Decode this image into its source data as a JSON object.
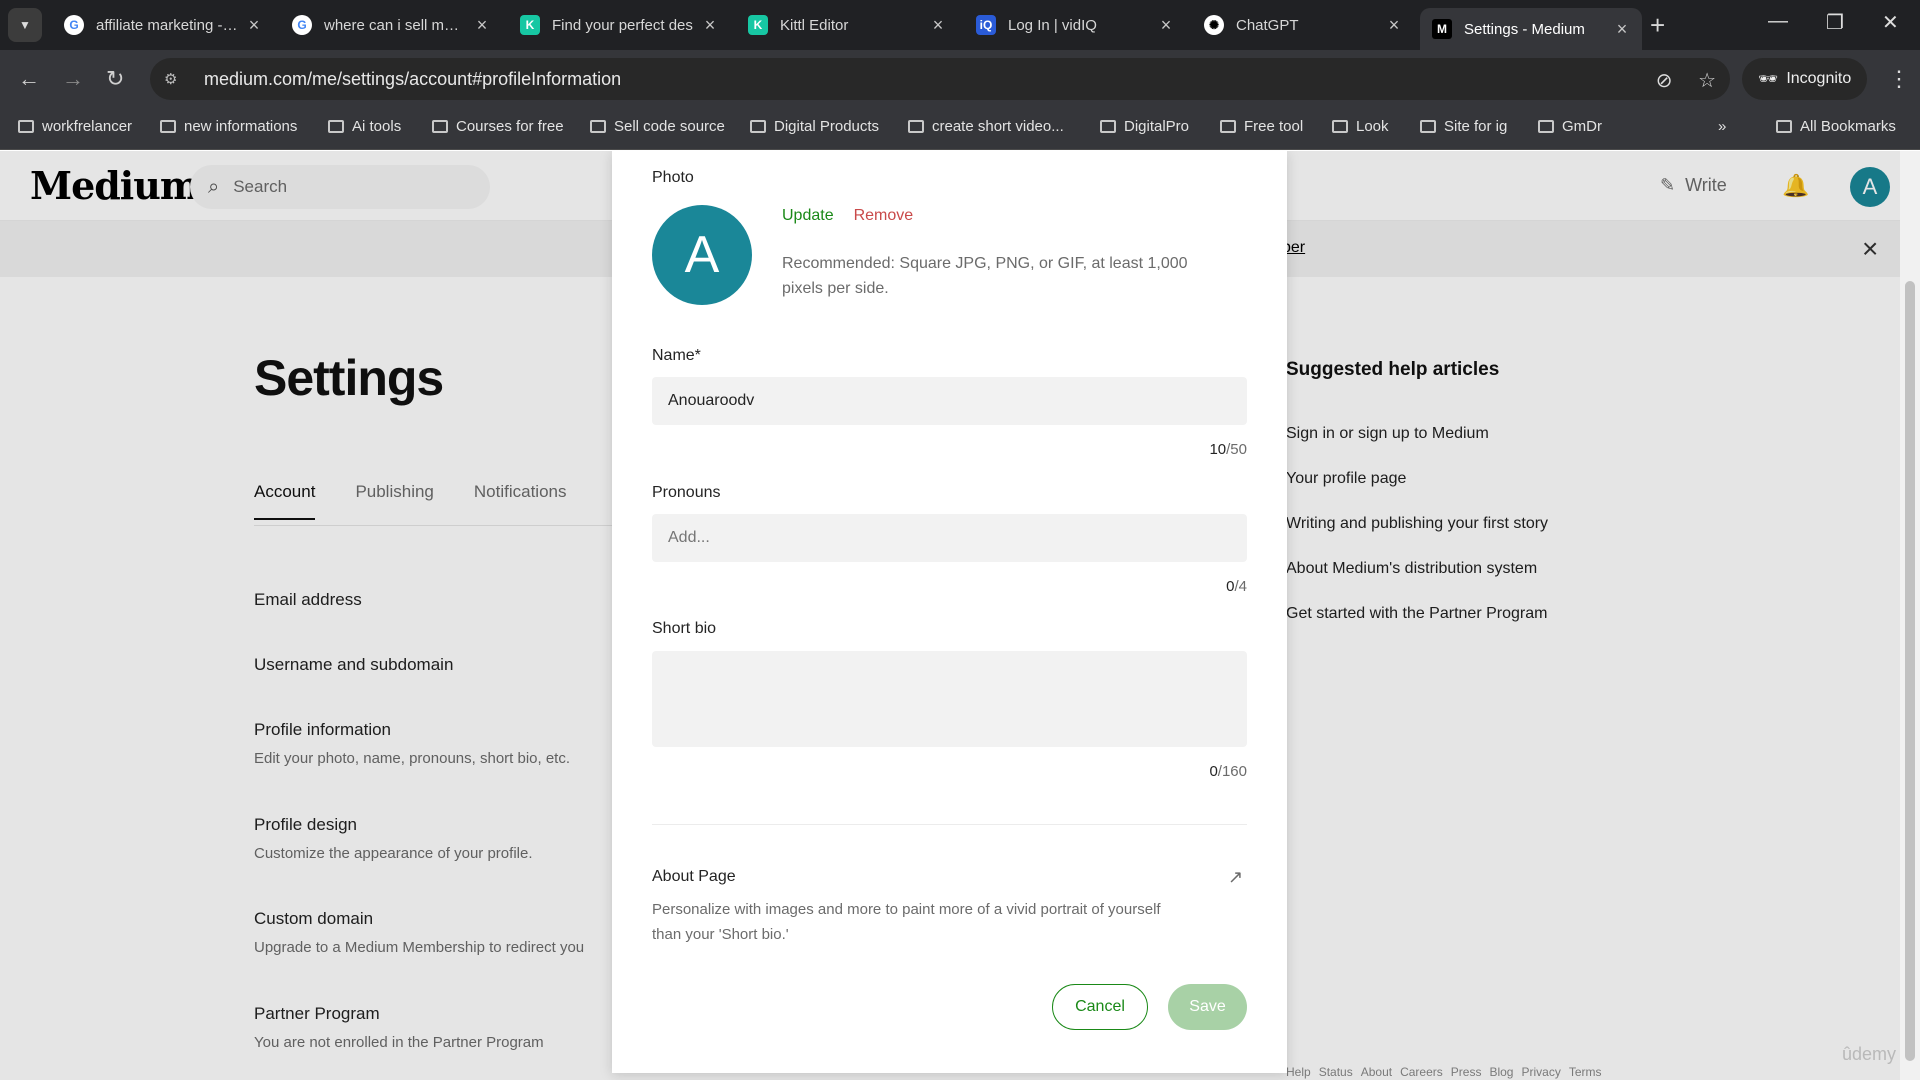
{
  "browser": {
    "tabs": [
      {
        "title": "affiliate marketing - G",
        "icon": "google-icon",
        "color": "#ffffff"
      },
      {
        "title": "where can i sell my ai",
        "icon": "google-icon",
        "color": "#ffffff"
      },
      {
        "title": "Find your perfect des",
        "icon": "kittl-icon",
        "color": "#17c7a3"
      },
      {
        "title": "Kittl Editor",
        "icon": "kittl-icon",
        "color": "#17c7a3"
      },
      {
        "title": "Log In | vidIQ",
        "icon": "vidiq-icon",
        "color": "#2a5bd7"
      },
      {
        "title": "ChatGPT",
        "icon": "openai-icon",
        "color": "#ffffff"
      },
      {
        "title": "Settings - Medium",
        "icon": "medium-icon",
        "color": "#000000",
        "active": true
      }
    ],
    "url": "medium.com/me/settings/account#profileInformation",
    "incognito_label": "Incognito",
    "bookmarks": [
      "workfrelancer",
      "new informations",
      "Ai tools",
      "Courses for free",
      "Sell code source",
      "Digital Products",
      "create short video...",
      "DigitalPro",
      "Free tool",
      "Look",
      "Site for ig",
      "GmDr"
    ],
    "all_bookmarks_label": "All Bookmarks"
  },
  "medium": {
    "logo": "Medium",
    "search_placeholder": "Search",
    "write_label": "Write",
    "avatar_letter": "A",
    "banner_link": "ber",
    "settings_title": "Settings",
    "tabs": [
      "Account",
      "Publishing",
      "Notifications"
    ],
    "rows": [
      {
        "title": "Email address",
        "sub": ""
      },
      {
        "title": "Username and subdomain",
        "sub": ""
      },
      {
        "title": "Profile information",
        "sub": "Edit your photo, name, pronouns, short bio, etc."
      },
      {
        "title": "Profile design",
        "sub": "Customize the appearance of your profile."
      },
      {
        "title": "Custom domain",
        "sub": "Upgrade to a Medium Membership to redirect you"
      },
      {
        "title": "Partner Program",
        "sub": "You are not enrolled in the Partner Program"
      }
    ],
    "help_title": "Suggested help articles",
    "help_links": [
      "Sign in or sign up to Medium",
      "Your profile page",
      "Writing and publishing your first story",
      "About Medium's distribution system",
      "Get started with the Partner Program"
    ],
    "footer_links": [
      "Help",
      "Status",
      "About",
      "Careers",
      "Press",
      "Blog",
      "Privacy",
      "Terms"
    ]
  },
  "modal": {
    "photo_label": "Photo",
    "photo_letter": "A",
    "update_label": "Update",
    "remove_label": "Remove",
    "photo_hint": "Recommended: Square JPG, PNG, or GIF, at least 1,000 pixels per side.",
    "name_label": "Name*",
    "name_value": "Anouaroodv",
    "name_count": "10",
    "name_max": "/50",
    "pronouns_label": "Pronouns",
    "pronouns_placeholder": "Add...",
    "pronouns_count": "0",
    "pronouns_max": "/4",
    "bio_label": "Short bio",
    "bio_count": "0",
    "bio_max": "/160",
    "about_title": "About Page",
    "about_desc": "Personalize with images and more to paint more of a vivid portrait of yourself than your 'Short bio.'",
    "cancel_label": "Cancel",
    "save_label": "Save"
  },
  "watermark": "ûdemy",
  "colors": {
    "accent_green": "#1a8917",
    "avatar_teal": "#1a8798",
    "remove_red": "#c94a4a"
  }
}
